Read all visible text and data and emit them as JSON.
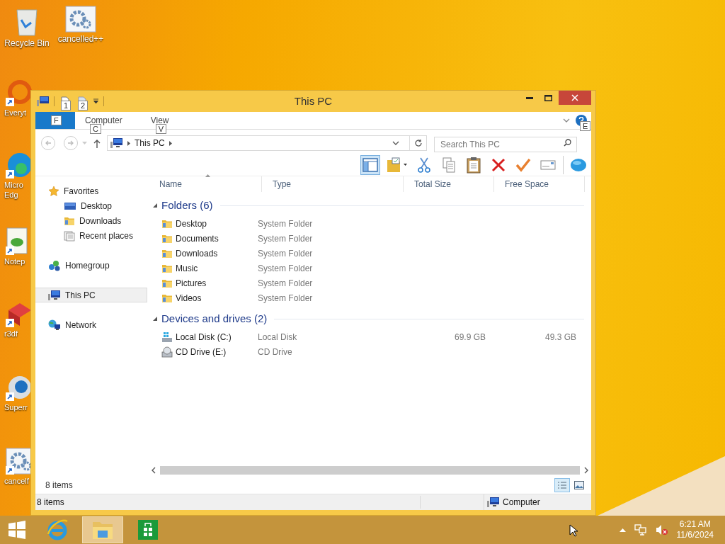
{
  "desktop_icons": [
    {
      "kind": "recycle",
      "label": "Recycle Bin"
    },
    {
      "kind": "gear",
      "label": "cancelled++"
    },
    {
      "kind": "search-ring",
      "label": "Everyt"
    },
    {
      "kind": "browser",
      "label": "Micro Edg"
    },
    {
      "kind": "notepad",
      "label": "Notep"
    },
    {
      "kind": "cube",
      "label": "r3df"
    },
    {
      "kind": "globe",
      "label": "Superr"
    },
    {
      "kind": "gear",
      "label": "cancelf"
    }
  ],
  "window": {
    "title": "This PC",
    "qat_keytips": [
      "1",
      "2"
    ],
    "file_tab": {
      "keytip": "F"
    },
    "tabs": [
      {
        "label": "Computer",
        "keytip": "C"
      },
      {
        "label": "View",
        "keytip": "V"
      }
    ],
    "help_keytip": "E",
    "address": {
      "path": [
        "This PC"
      ]
    },
    "search": {
      "placeholder": "Search This PC"
    },
    "toolbar_buttons": [
      {
        "kind": "pane",
        "selected": true
      },
      {
        "kind": "folder-check",
        "selected": false
      },
      {
        "kind": "cut",
        "selected": false
      },
      {
        "kind": "copy",
        "selected": false
      },
      {
        "kind": "paste",
        "selected": false
      },
      {
        "kind": "delete",
        "selected": false
      },
      {
        "kind": "check",
        "selected": false
      },
      {
        "kind": "rename",
        "selected": false
      },
      {
        "kind": "blob",
        "selected": false
      }
    ],
    "nav": [
      {
        "kind": "star",
        "label": "Favorites",
        "selected": false,
        "children": [
          {
            "kind": "screen",
            "label": "Desktop",
            "selected": false
          },
          {
            "kind": "folder",
            "label": "Downloads",
            "selected": false
          },
          {
            "kind": "recent",
            "label": "Recent places",
            "selected": false
          }
        ]
      },
      {
        "kind": "homegroup",
        "label": "Homegroup",
        "selected": false
      },
      {
        "kind": "pc",
        "label": "This PC",
        "selected": true
      },
      {
        "kind": "network",
        "label": "Network",
        "selected": false
      }
    ],
    "columns": [
      "Name",
      "Type",
      "Total Size",
      "Free Space"
    ],
    "groups": [
      {
        "title": "Folders (6)",
        "items": [
          {
            "kind": "folder",
            "name": "Desktop",
            "type": "System Folder"
          },
          {
            "kind": "folder",
            "name": "Documents",
            "type": "System Folder"
          },
          {
            "kind": "folder",
            "name": "Downloads",
            "type": "System Folder"
          },
          {
            "kind": "folder",
            "name": "Music",
            "type": "System Folder"
          },
          {
            "kind": "folder",
            "name": "Pictures",
            "type": "System Folder"
          },
          {
            "kind": "folder",
            "name": "Videos",
            "type": "System Folder"
          }
        ]
      },
      {
        "title": "Devices and drives (2)",
        "items": [
          {
            "kind": "hdd",
            "name": "Local Disk (C:)",
            "type": "Local Disk",
            "total_size": "69.9 GB",
            "free_space": "49.3 GB"
          },
          {
            "kind": "cd",
            "name": "CD Drive (E:)",
            "type": "CD Drive"
          }
        ]
      }
    ],
    "content_count": "8 items",
    "view_buttons": [
      {
        "kind": "details",
        "selected": true
      },
      {
        "kind": "thumbnails",
        "selected": false
      }
    ],
    "status_bar": {
      "left": "8 items",
      "right": "Computer"
    }
  },
  "taskbar": {
    "apps": [
      {
        "kind": "ie",
        "selected": false
      },
      {
        "kind": "explorer",
        "selected": true
      },
      {
        "kind": "store",
        "selected": false
      }
    ],
    "time": "6:21 AM",
    "date": "11/6/2024"
  }
}
